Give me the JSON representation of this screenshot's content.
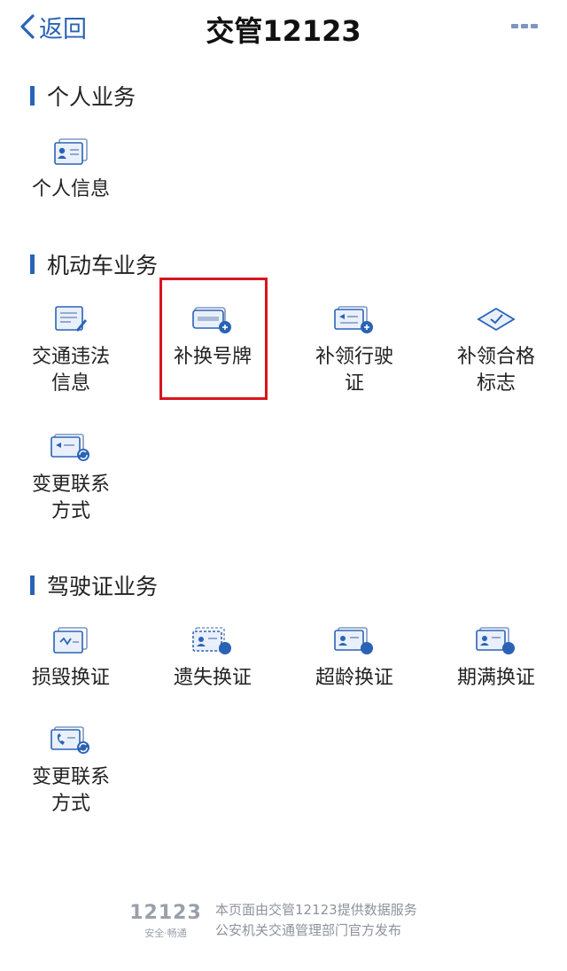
{
  "navbar": {
    "back_label": "返回",
    "title": "交管12123"
  },
  "sections": {
    "personal": {
      "title": "个人业务",
      "items": [
        {
          "label": "个人信息",
          "icon": "id-card-icon"
        }
      ]
    },
    "vehicle": {
      "title": "机动车业务",
      "items": [
        {
          "label": "交通违法\n信息",
          "icon": "violation-form-icon"
        },
        {
          "label": "补换号牌",
          "icon": "license-plate-replace-icon"
        },
        {
          "label": "补领行驶\n证",
          "icon": "driving-permit-reissue-icon"
        },
        {
          "label": "补领合格\n标志",
          "icon": "inspection-mark-icon"
        },
        {
          "label": "变更联系\n方式",
          "icon": "contact-change-icon"
        }
      ]
    },
    "license": {
      "title": "驾驶证业务",
      "items": [
        {
          "label": "损毁换证",
          "icon": "damaged-license-icon"
        },
        {
          "label": "遗失换证",
          "icon": "lost-license-icon"
        },
        {
          "label": "超龄换证",
          "icon": "overage-license-icon"
        },
        {
          "label": "期满换证",
          "icon": "expired-license-icon"
        },
        {
          "label": "变更联系\n方式",
          "icon": "phone-contact-change-icon"
        }
      ]
    }
  },
  "highlighted_item": "补换号牌",
  "footer": {
    "logo_number": "12123",
    "logo_tagline": "安全·畅通",
    "line1": "本页面由交管12123提供数据服务",
    "line2": "公安机关交通管理部门官方发布"
  },
  "colors": {
    "accent": "#2a63b5",
    "highlight_border": "#d8151e",
    "icon_fill": "#e9f0fb"
  }
}
